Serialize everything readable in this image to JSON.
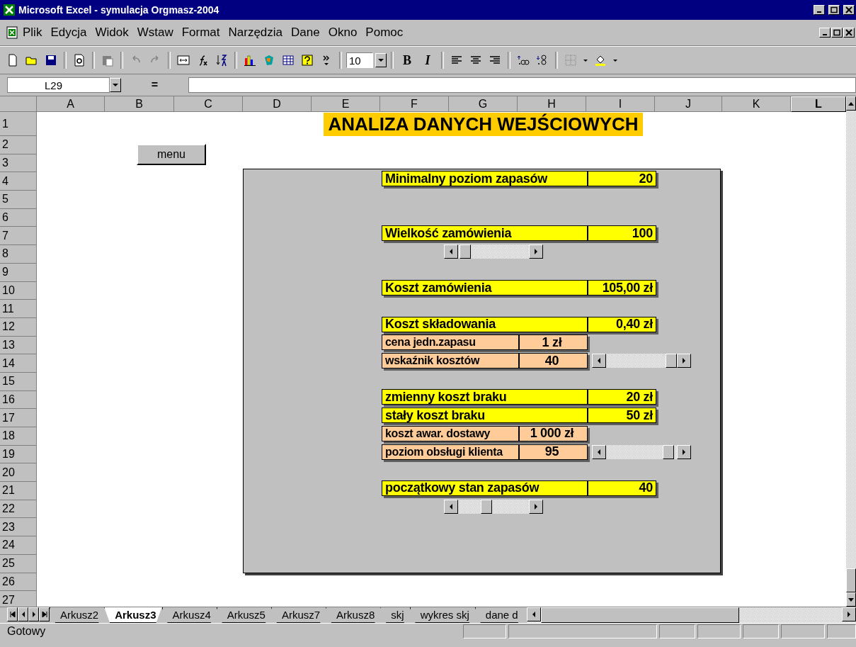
{
  "window": {
    "title": "Microsoft Excel - symulacja Orgmasz-2004"
  },
  "menu_bar": {
    "items": [
      "Plik",
      "Edycja",
      "Widok",
      "Wstaw",
      "Format",
      "Narzędzia",
      "Dane",
      "Okno",
      "Pomoc"
    ]
  },
  "toolbar": {
    "font_size": "10",
    "bold": "B",
    "italic": "I"
  },
  "formula_bar": {
    "name_box": "L29",
    "equals": "="
  },
  "columns": [
    {
      "label": "A",
      "selected": false
    },
    {
      "label": "B",
      "selected": false
    },
    {
      "label": "C",
      "selected": false
    },
    {
      "label": "D",
      "selected": false
    },
    {
      "label": "E",
      "selected": false
    },
    {
      "label": "F",
      "selected": false
    },
    {
      "label": "G",
      "selected": false
    },
    {
      "label": "H",
      "selected": false
    },
    {
      "label": "I",
      "selected": false
    },
    {
      "label": "J",
      "selected": false
    },
    {
      "label": "K",
      "selected": false
    },
    {
      "label": "L",
      "selected": true
    }
  ],
  "rows": [
    "1",
    "2",
    "3",
    "4",
    "5",
    "6",
    "7",
    "8",
    "9",
    "10",
    "11",
    "12",
    "13",
    "14",
    "15",
    "16",
    "17",
    "18",
    "19",
    "20",
    "21",
    "22",
    "23",
    "24",
    "25",
    "26",
    "27"
  ],
  "sheet": {
    "title": "ANALIZA DANYCH WEJŚCIOWYCH",
    "button": "menu",
    "panel": {
      "groups": [
        [
          {
            "kind": "main",
            "label": "Minimalny poziom zapasów",
            "value": "20"
          }
        ],
        [
          {
            "kind": "main",
            "label": "Wielkość zamówienia",
            "value": "100"
          },
          {
            "kind": "scrollbar",
            "level": 0.02
          }
        ],
        [
          {
            "kind": "main",
            "label": "Koszt zamówienia",
            "value": "105,00 zł"
          }
        ],
        [
          {
            "kind": "main",
            "label": "Koszt składowania",
            "value": "0,40 zł"
          },
          {
            "kind": "sub",
            "label": "cena jedn.zapasu",
            "value": "1 zł"
          },
          {
            "kind": "sub",
            "label": "wskaźnik kosztów",
            "value": "40",
            "scrollbar": {
              "level": 1
            }
          }
        ],
        [
          {
            "kind": "main",
            "label": "zmienny koszt braku",
            "value": "20 zł"
          },
          {
            "kind": "main",
            "label": "stały koszt braku",
            "value": "50 zł"
          },
          {
            "kind": "sub",
            "label": "koszt awar. dostawy",
            "value": "1 000 zł"
          },
          {
            "kind": "sub",
            "label": "poziom obsługi klienta",
            "value": "95",
            "scrollbar": {
              "level": 0.95
            }
          }
        ],
        [
          {
            "kind": "main",
            "label": "początkowy stan zapasów",
            "value": "40"
          },
          {
            "kind": "scrollbar",
            "level": 0.38
          }
        ]
      ]
    }
  },
  "sheet_tabs": [
    {
      "label": "Arkusz2",
      "selected": false
    },
    {
      "label": "Arkusz3",
      "selected": true
    },
    {
      "label": "Arkusz4",
      "selected": false
    },
    {
      "label": "Arkusz5",
      "selected": false
    },
    {
      "label": "Arkusz7",
      "selected": false
    },
    {
      "label": "Arkusz8",
      "selected": false
    },
    {
      "label": "skj",
      "selected": false
    },
    {
      "label": "wykres skj",
      "selected": false
    },
    {
      "label": "dane d",
      "selected": false
    }
  ],
  "status_bar": {
    "text": "Gotowy"
  }
}
